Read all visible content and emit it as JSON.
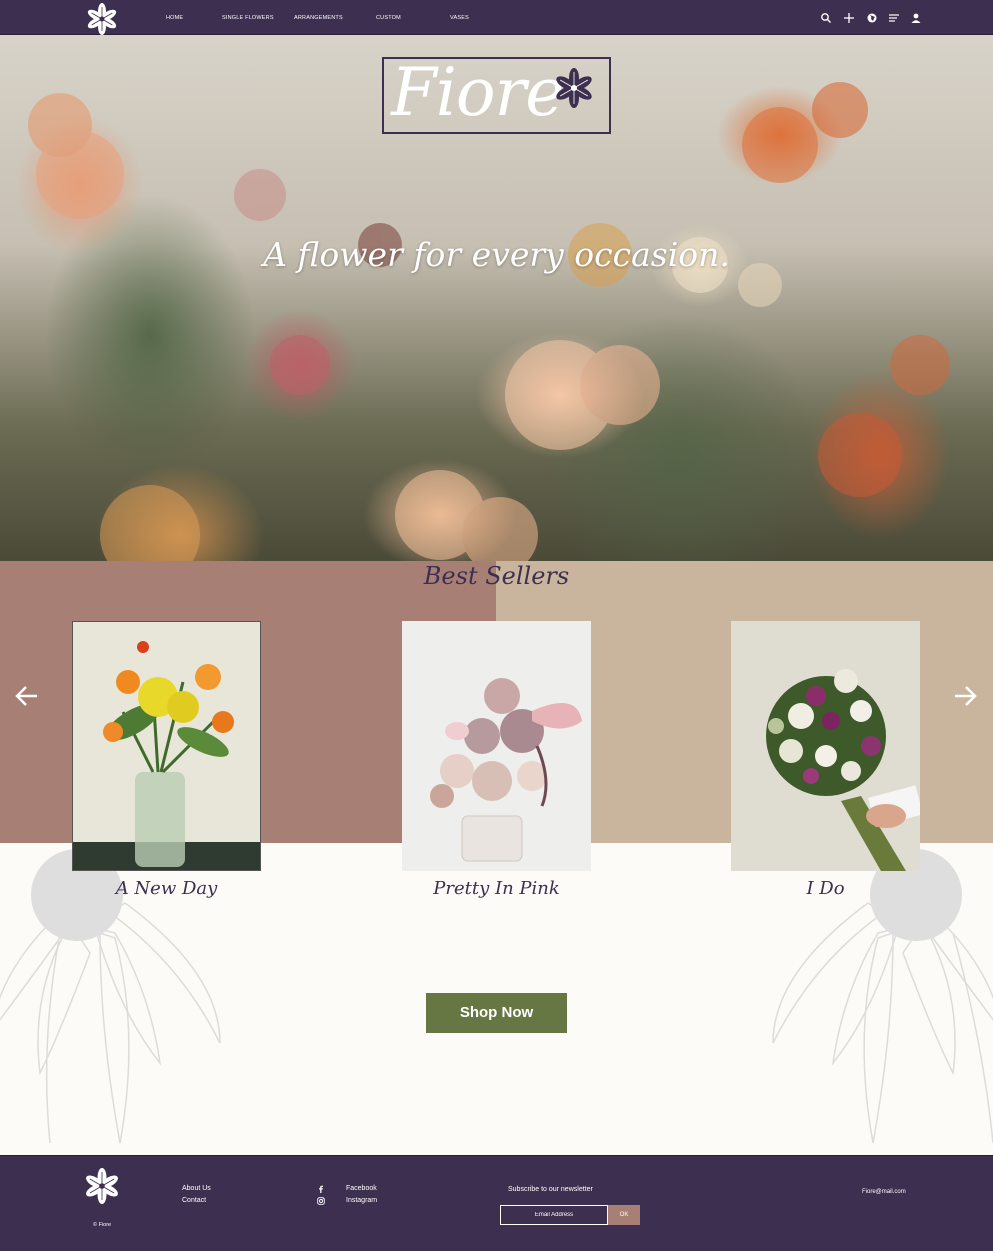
{
  "brand": {
    "name": "Fiore",
    "tagline": "A flower for every occasion."
  },
  "nav": {
    "items": [
      {
        "label": "HOME"
      },
      {
        "label": "SINGLE FLOWERS"
      },
      {
        "label": "ARRANGEMENTS"
      },
      {
        "label": "CUSTOM"
      },
      {
        "label": "VASES"
      }
    ],
    "icons": [
      "search-icon",
      "plus-icon",
      "globe-icon",
      "menu-icon",
      "user-icon"
    ]
  },
  "best_sellers": {
    "title": "Best Sellers",
    "products": [
      {
        "name": "A New Day"
      },
      {
        "name": "Pretty In Pink"
      },
      {
        "name": "I Do"
      }
    ]
  },
  "cta": {
    "label": "Shop Now"
  },
  "footer": {
    "copyright": "© Fiore",
    "links": [
      "About Us",
      "Contact"
    ],
    "social": [
      {
        "label": "Facebook",
        "icon": "facebook-icon"
      },
      {
        "label": "Instagram",
        "icon": "instagram-icon"
      }
    ],
    "newsletter": {
      "title": "Subscribe to our newsletter",
      "placeholder": "Email Address",
      "button": "OK"
    },
    "email": "Fiore@mail.com"
  },
  "colors": {
    "nav_purple": "#3d2f4f",
    "rose": "#a77f75",
    "tan": "#c9b49e",
    "cream": "#fcfbf7",
    "olive_button": "#667743"
  }
}
